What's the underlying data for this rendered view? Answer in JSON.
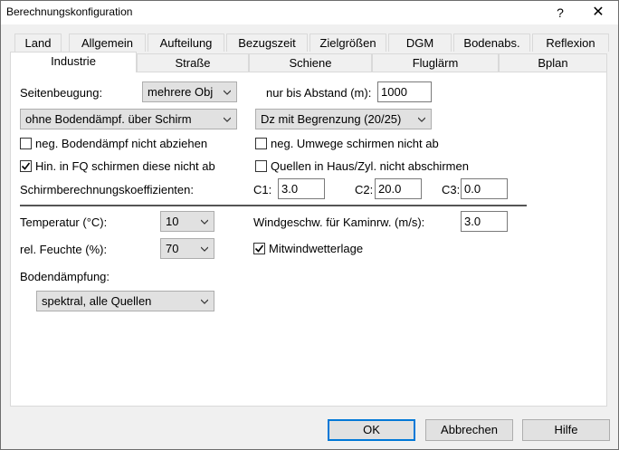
{
  "window": {
    "title": "Berechnungskonfiguration",
    "help": "?",
    "close": "✕"
  },
  "tabs_row1": [
    "Land",
    "Allgemein",
    "Aufteilung",
    "Bezugszeit",
    "Zielgrößen",
    "DGM",
    "Bodenabs.",
    "Reflexion"
  ],
  "tabs_row2": [
    "Industrie",
    "Straße",
    "Schiene",
    "Fluglärm",
    "Bplan"
  ],
  "active_tab": "Industrie",
  "form": {
    "seitenbeugung_label": "Seitenbeugung:",
    "seitenbeugung_value": "mehrere Obj",
    "abstand_label": "nur bis Abstand (m):",
    "abstand_value": "1000",
    "boden_schirm_value": "ohne Bodendämpf. über Schirm",
    "dz_value": "Dz mit Begrenzung (20/25)",
    "cb_neg_boden": {
      "label": "neg. Bodendämpf nicht abziehen",
      "checked": false
    },
    "cb_neg_umwege": {
      "label": "neg. Umwege schirmen nicht ab",
      "checked": false
    },
    "cb_hin_fq": {
      "label": "Hin. in FQ schirmen diese nicht ab",
      "checked": true
    },
    "cb_quellen": {
      "label": "Quellen in Haus/Zyl. nicht abschirmen",
      "checked": false
    },
    "koeff_label": "Schirmberechnungskoeffizienten:",
    "c1_label": "C1:",
    "c1_value": "3.0",
    "c2_label": "C2:",
    "c2_value": "20.0",
    "c3_label": "C3:",
    "c3_value": "0.0",
    "temp_label": "Temperatur (°C):",
    "temp_value": "10",
    "feuchte_label": "rel. Feuchte (%):",
    "feuchte_value": "70",
    "wind_label": "Windgeschw. für Kaminrw. (m/s):",
    "wind_value": "3.0",
    "cb_mitwind": {
      "label": "Mitwindwetterlage",
      "checked": true
    },
    "bodendaempfung_label": "Bodendämpfung:",
    "bodendaempfung_value": "spektral, alle Quellen"
  },
  "buttons": {
    "ok": "OK",
    "cancel": "Abbrechen",
    "help": "Hilfe"
  }
}
